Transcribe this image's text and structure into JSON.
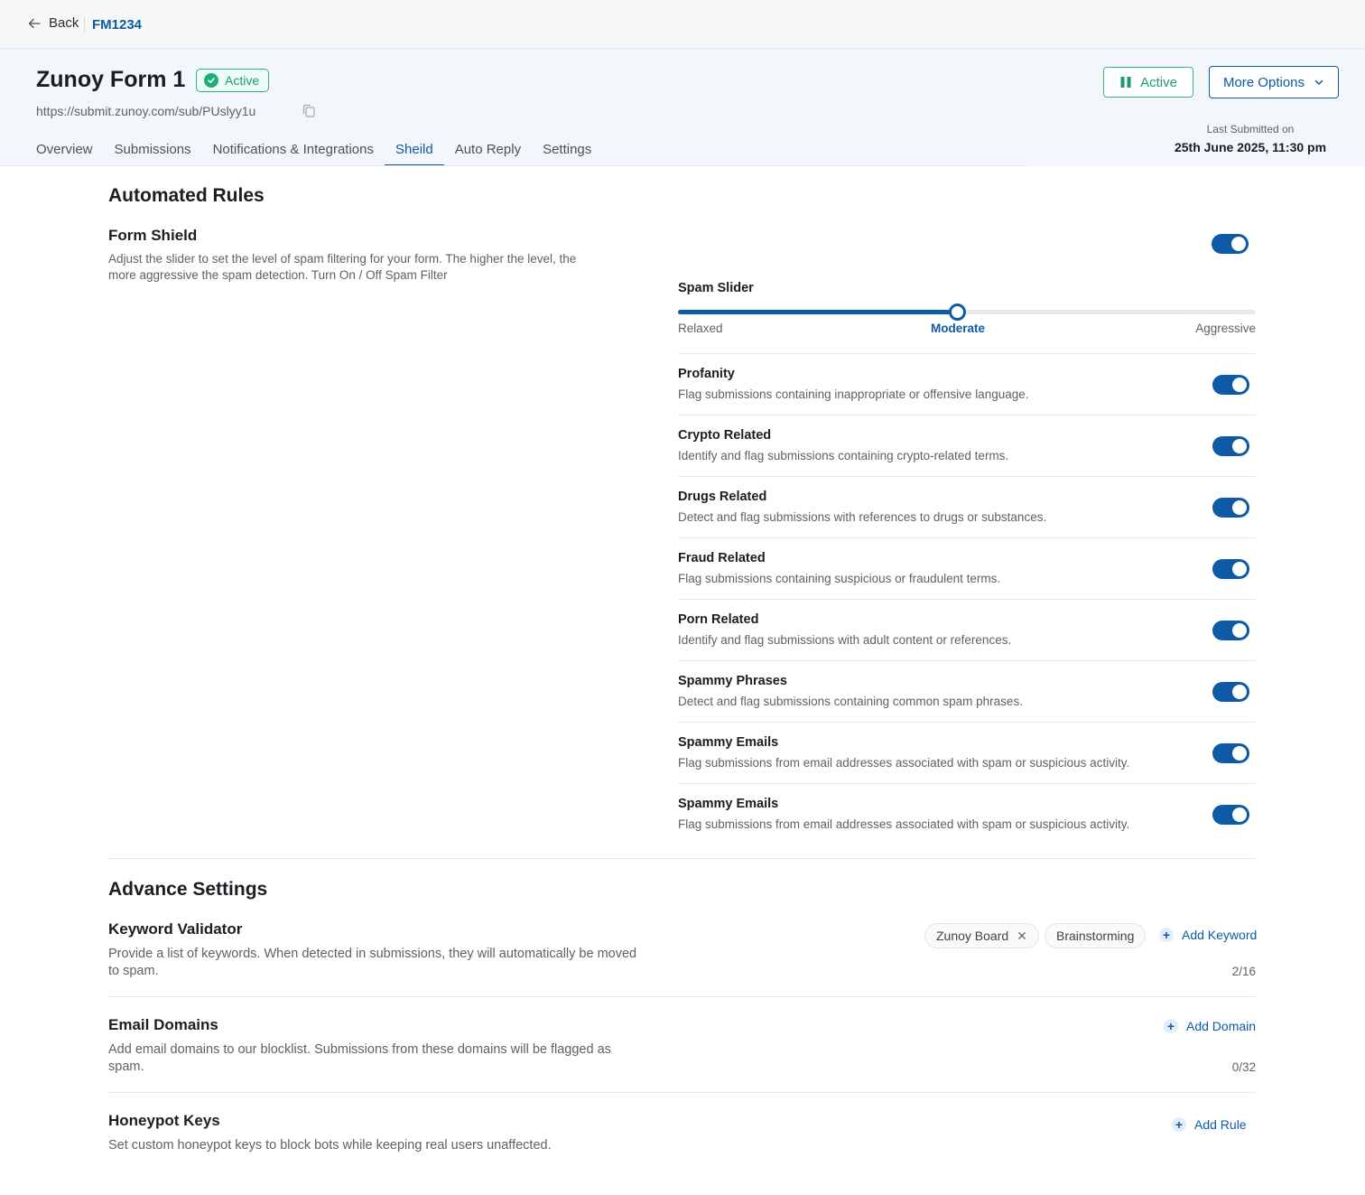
{
  "topbar": {
    "back_label": "Back",
    "form_id": "FM1234"
  },
  "header": {
    "title": "Zunoy Form 1",
    "status_badge": "Active",
    "url": "https://submit.zunoy.com/sub/PUslyy1u",
    "active_button": "Active",
    "more_options": "More Options",
    "last_submitted_label": "Last Submitted on",
    "last_submitted_value": "25th June 2025, 11:30 pm"
  },
  "tabs": [
    "Overview",
    "Submissions",
    "Notifications & Integrations",
    "Sheild",
    "Auto Reply",
    "Settings"
  ],
  "active_tab": "Sheild",
  "automated_rules": {
    "heading": "Automated Rules",
    "form_shield": {
      "title": "Form Shield",
      "desc_line1": "Adjust the slider to set the level of spam filtering for your form. The higher the level, the",
      "desc_line2": "more aggressive the spam detection. Turn On / Off Spam Filter",
      "enabled": true
    },
    "spam_slider": {
      "title": "Spam Slider",
      "labels": [
        "Relaxed",
        "Moderate",
        "Aggressive"
      ],
      "selected": "Moderate",
      "value_fraction": 0.5
    },
    "rules": [
      {
        "title": "Profanity",
        "desc": "Flag submissions containing inappropriate or offensive language.",
        "enabled": true
      },
      {
        "title": "Crypto Related",
        "desc": "Identify and flag submissions containing crypto-related terms.",
        "enabled": true
      },
      {
        "title": "Drugs Related",
        "desc": "Detect and flag submissions with references to drugs or substances.",
        "enabled": true
      },
      {
        "title": "Fraud Related",
        "desc": "Flag submissions containing suspicious or fraudulent terms.",
        "enabled": true
      },
      {
        "title": "Porn Related",
        "desc": "Identify and flag submissions with adult content or references.",
        "enabled": true
      },
      {
        "title": "Spammy Phrases",
        "desc": "Detect and flag submissions containing common spam phrases.",
        "enabled": true
      },
      {
        "title": "Spammy Emails",
        "desc": "Flag submissions from email addresses associated with spam or suspicious activity.",
        "enabled": true
      },
      {
        "title": "Spammy Emails",
        "desc": "Flag submissions from email addresses associated with spam or suspicious activity.",
        "enabled": true
      }
    ]
  },
  "advance_settings": {
    "heading": "Advance Settings",
    "keyword_validator": {
      "title": "Keyword Validator",
      "desc_line1": "Provide a list of keywords. When detected in submissions, they will automatically be moved",
      "desc_line2": "to spam.",
      "keywords": [
        "Zunoy Board",
        "Brainstorming"
      ],
      "add_label": "Add Keyword",
      "count": "2/16"
    },
    "email_domains": {
      "title": "Email Domains",
      "desc_line1": "Add email domains to our blocklist. Submissions from these domains will be flagged as",
      "desc_line2": "spam.",
      "add_label": "Add Domain",
      "count": "0/32"
    },
    "honeypot_keys": {
      "title": "Honeypot Keys",
      "desc": "Set custom honeypot keys to block bots while keeping real users unaffected.",
      "add_label": "Add Rule"
    }
  },
  "colors": {
    "primary": "#0d5aa7",
    "success": "#1e9a6e",
    "header_bg": "#f3f7fb"
  },
  "icons": {
    "back": "arrow-left-icon",
    "badge": "check-circle-icon",
    "copy": "copy-icon",
    "active_button": "pause-icon",
    "more": "chevron-down-icon",
    "add": "plus-icon",
    "remove_chip": "close-icon"
  }
}
